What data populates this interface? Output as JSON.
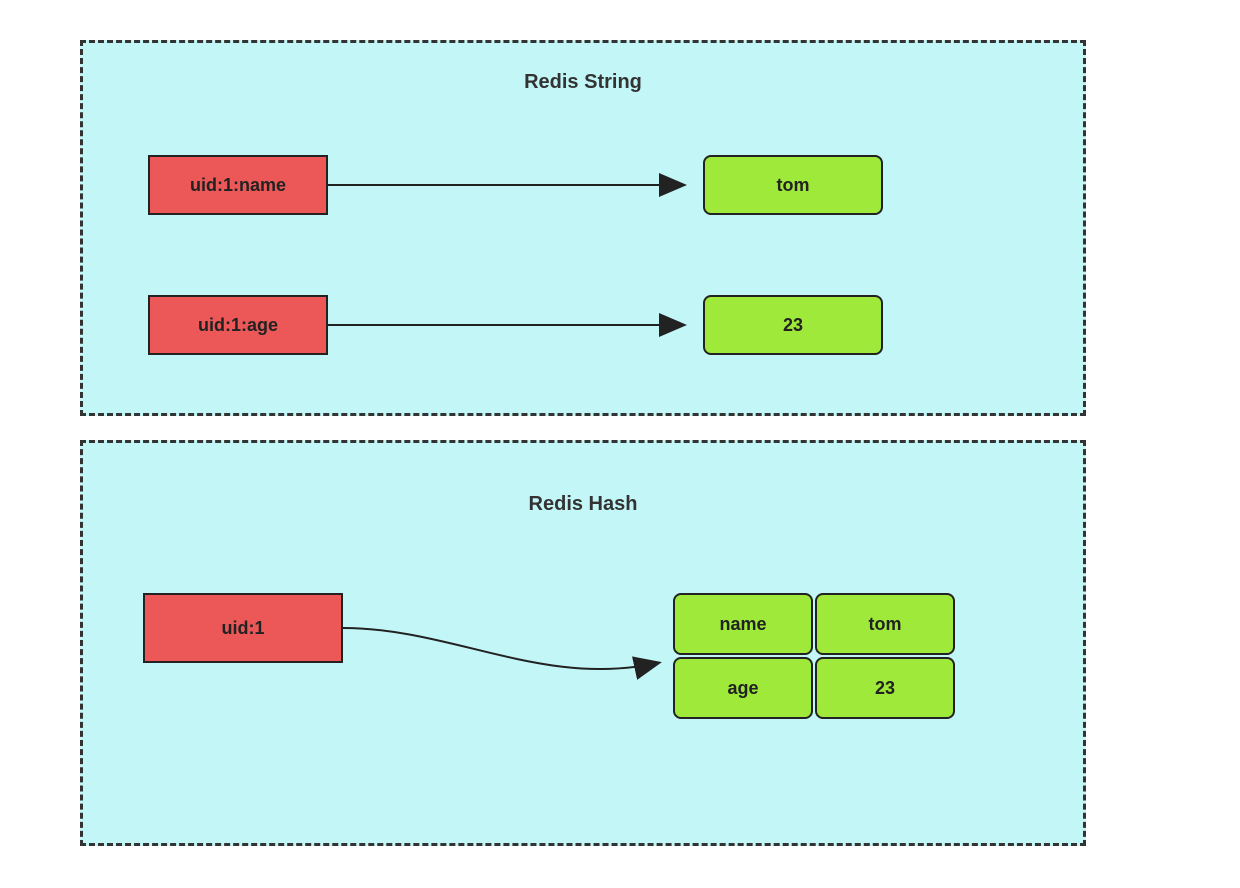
{
  "panels": {
    "string": {
      "title": "Redis String",
      "rows": [
        {
          "key": "uid:1:name",
          "value": "tom"
        },
        {
          "key": "uid:1:age",
          "value": "23"
        }
      ]
    },
    "hash": {
      "title": "Redis Hash",
      "key": "uid:1",
      "fields": [
        {
          "field": "name",
          "value": "tom"
        },
        {
          "field": "age",
          "value": "23"
        }
      ]
    }
  },
  "colors": {
    "panel_bg": "#c3f7f7",
    "key_bg": "#ec5858",
    "val_bg": "#9ee93a",
    "border": "#222222"
  }
}
